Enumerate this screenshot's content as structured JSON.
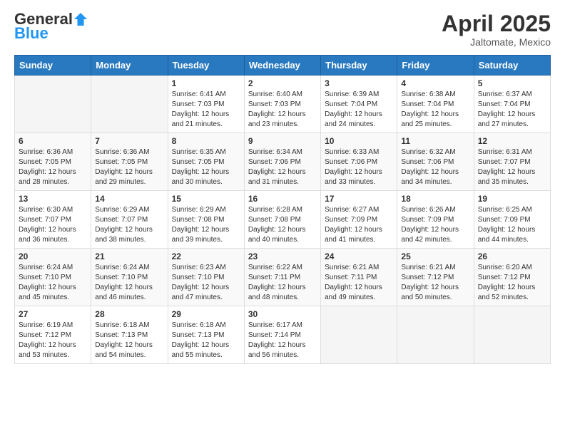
{
  "logo": {
    "general": "General",
    "blue": "Blue"
  },
  "header": {
    "month": "April 2025",
    "location": "Jaltomate, Mexico"
  },
  "weekdays": [
    "Sunday",
    "Monday",
    "Tuesday",
    "Wednesday",
    "Thursday",
    "Friday",
    "Saturday"
  ],
  "weeks": [
    [
      {
        "day": "",
        "sunrise": "",
        "sunset": "",
        "daylight": ""
      },
      {
        "day": "",
        "sunrise": "",
        "sunset": "",
        "daylight": ""
      },
      {
        "day": "1",
        "sunrise": "Sunrise: 6:41 AM",
        "sunset": "Sunset: 7:03 PM",
        "daylight": "Daylight: 12 hours and 21 minutes."
      },
      {
        "day": "2",
        "sunrise": "Sunrise: 6:40 AM",
        "sunset": "Sunset: 7:03 PM",
        "daylight": "Daylight: 12 hours and 23 minutes."
      },
      {
        "day": "3",
        "sunrise": "Sunrise: 6:39 AM",
        "sunset": "Sunset: 7:04 PM",
        "daylight": "Daylight: 12 hours and 24 minutes."
      },
      {
        "day": "4",
        "sunrise": "Sunrise: 6:38 AM",
        "sunset": "Sunset: 7:04 PM",
        "daylight": "Daylight: 12 hours and 25 minutes."
      },
      {
        "day": "5",
        "sunrise": "Sunrise: 6:37 AM",
        "sunset": "Sunset: 7:04 PM",
        "daylight": "Daylight: 12 hours and 27 minutes."
      }
    ],
    [
      {
        "day": "6",
        "sunrise": "Sunrise: 6:36 AM",
        "sunset": "Sunset: 7:05 PM",
        "daylight": "Daylight: 12 hours and 28 minutes."
      },
      {
        "day": "7",
        "sunrise": "Sunrise: 6:36 AM",
        "sunset": "Sunset: 7:05 PM",
        "daylight": "Daylight: 12 hours and 29 minutes."
      },
      {
        "day": "8",
        "sunrise": "Sunrise: 6:35 AM",
        "sunset": "Sunset: 7:05 PM",
        "daylight": "Daylight: 12 hours and 30 minutes."
      },
      {
        "day": "9",
        "sunrise": "Sunrise: 6:34 AM",
        "sunset": "Sunset: 7:06 PM",
        "daylight": "Daylight: 12 hours and 31 minutes."
      },
      {
        "day": "10",
        "sunrise": "Sunrise: 6:33 AM",
        "sunset": "Sunset: 7:06 PM",
        "daylight": "Daylight: 12 hours and 33 minutes."
      },
      {
        "day": "11",
        "sunrise": "Sunrise: 6:32 AM",
        "sunset": "Sunset: 7:06 PM",
        "daylight": "Daylight: 12 hours and 34 minutes."
      },
      {
        "day": "12",
        "sunrise": "Sunrise: 6:31 AM",
        "sunset": "Sunset: 7:07 PM",
        "daylight": "Daylight: 12 hours and 35 minutes."
      }
    ],
    [
      {
        "day": "13",
        "sunrise": "Sunrise: 6:30 AM",
        "sunset": "Sunset: 7:07 PM",
        "daylight": "Daylight: 12 hours and 36 minutes."
      },
      {
        "day": "14",
        "sunrise": "Sunrise: 6:29 AM",
        "sunset": "Sunset: 7:07 PM",
        "daylight": "Daylight: 12 hours and 38 minutes."
      },
      {
        "day": "15",
        "sunrise": "Sunrise: 6:29 AM",
        "sunset": "Sunset: 7:08 PM",
        "daylight": "Daylight: 12 hours and 39 minutes."
      },
      {
        "day": "16",
        "sunrise": "Sunrise: 6:28 AM",
        "sunset": "Sunset: 7:08 PM",
        "daylight": "Daylight: 12 hours and 40 minutes."
      },
      {
        "day": "17",
        "sunrise": "Sunrise: 6:27 AM",
        "sunset": "Sunset: 7:09 PM",
        "daylight": "Daylight: 12 hours and 41 minutes."
      },
      {
        "day": "18",
        "sunrise": "Sunrise: 6:26 AM",
        "sunset": "Sunset: 7:09 PM",
        "daylight": "Daylight: 12 hours and 42 minutes."
      },
      {
        "day": "19",
        "sunrise": "Sunrise: 6:25 AM",
        "sunset": "Sunset: 7:09 PM",
        "daylight": "Daylight: 12 hours and 44 minutes."
      }
    ],
    [
      {
        "day": "20",
        "sunrise": "Sunrise: 6:24 AM",
        "sunset": "Sunset: 7:10 PM",
        "daylight": "Daylight: 12 hours and 45 minutes."
      },
      {
        "day": "21",
        "sunrise": "Sunrise: 6:24 AM",
        "sunset": "Sunset: 7:10 PM",
        "daylight": "Daylight: 12 hours and 46 minutes."
      },
      {
        "day": "22",
        "sunrise": "Sunrise: 6:23 AM",
        "sunset": "Sunset: 7:10 PM",
        "daylight": "Daylight: 12 hours and 47 minutes."
      },
      {
        "day": "23",
        "sunrise": "Sunrise: 6:22 AM",
        "sunset": "Sunset: 7:11 PM",
        "daylight": "Daylight: 12 hours and 48 minutes."
      },
      {
        "day": "24",
        "sunrise": "Sunrise: 6:21 AM",
        "sunset": "Sunset: 7:11 PM",
        "daylight": "Daylight: 12 hours and 49 minutes."
      },
      {
        "day": "25",
        "sunrise": "Sunrise: 6:21 AM",
        "sunset": "Sunset: 7:12 PM",
        "daylight": "Daylight: 12 hours and 50 minutes."
      },
      {
        "day": "26",
        "sunrise": "Sunrise: 6:20 AM",
        "sunset": "Sunset: 7:12 PM",
        "daylight": "Daylight: 12 hours and 52 minutes."
      }
    ],
    [
      {
        "day": "27",
        "sunrise": "Sunrise: 6:19 AM",
        "sunset": "Sunset: 7:12 PM",
        "daylight": "Daylight: 12 hours and 53 minutes."
      },
      {
        "day": "28",
        "sunrise": "Sunrise: 6:18 AM",
        "sunset": "Sunset: 7:13 PM",
        "daylight": "Daylight: 12 hours and 54 minutes."
      },
      {
        "day": "29",
        "sunrise": "Sunrise: 6:18 AM",
        "sunset": "Sunset: 7:13 PM",
        "daylight": "Daylight: 12 hours and 55 minutes."
      },
      {
        "day": "30",
        "sunrise": "Sunrise: 6:17 AM",
        "sunset": "Sunset: 7:14 PM",
        "daylight": "Daylight: 12 hours and 56 minutes."
      },
      {
        "day": "",
        "sunrise": "",
        "sunset": "",
        "daylight": ""
      },
      {
        "day": "",
        "sunrise": "",
        "sunset": "",
        "daylight": ""
      },
      {
        "day": "",
        "sunrise": "",
        "sunset": "",
        "daylight": ""
      }
    ]
  ]
}
